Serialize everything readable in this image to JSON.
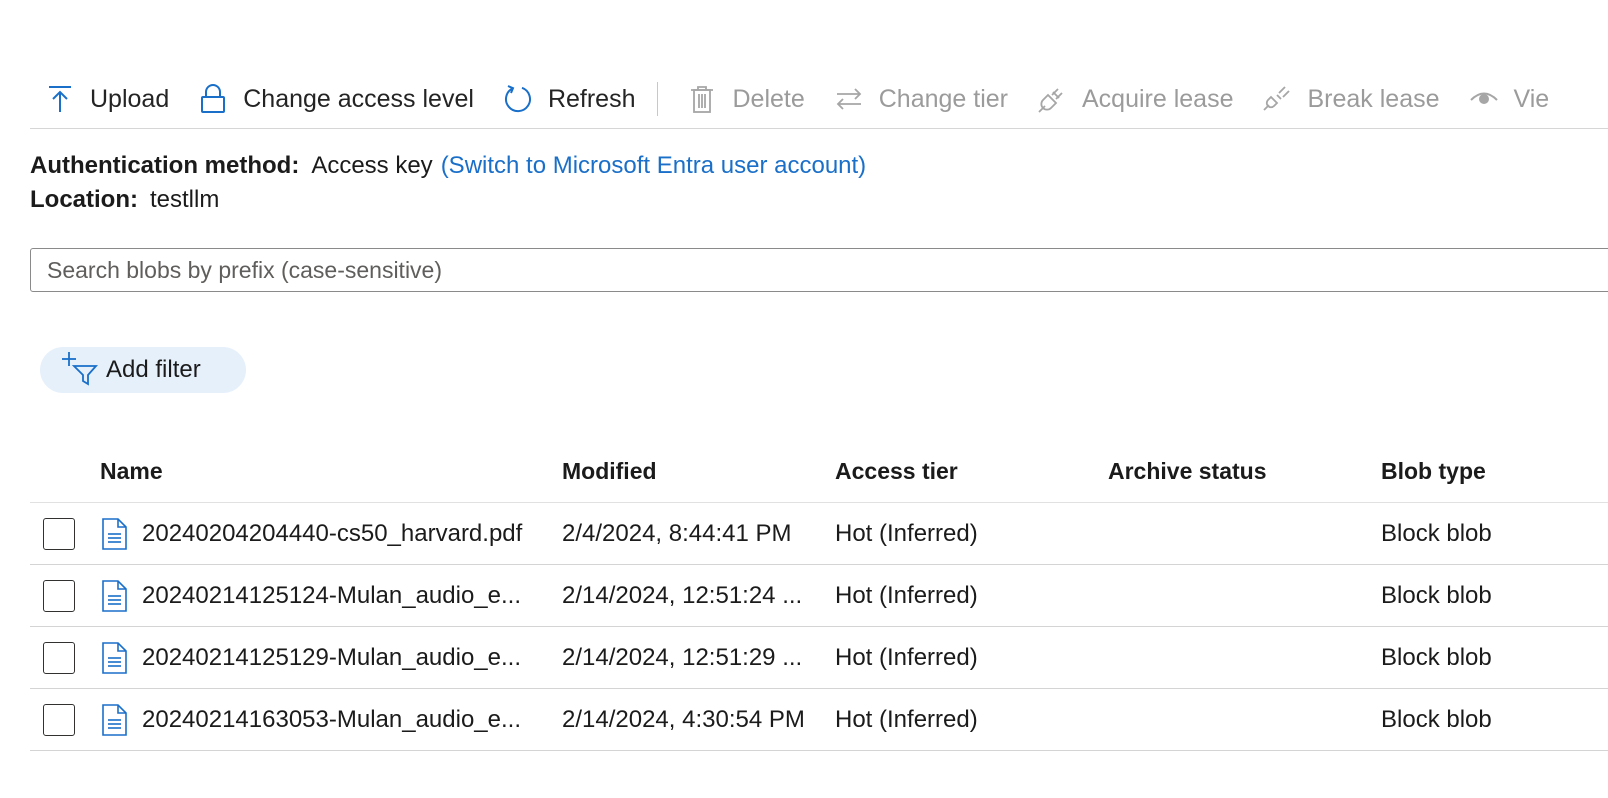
{
  "toolbar": {
    "upload": "Upload",
    "change_access": "Change access level",
    "refresh": "Refresh",
    "delete": "Delete",
    "change_tier": "Change tier",
    "acquire_lease": "Acquire lease",
    "break_lease": "Break lease",
    "view": "Vie"
  },
  "auth": {
    "method_label": "Authentication method:",
    "method_value": "Access key",
    "switch_link": "(Switch to Microsoft Entra user account)",
    "location_label": "Location:",
    "location_value": "testllm"
  },
  "search": {
    "placeholder": "Search blobs by prefix (case-sensitive)",
    "value": ""
  },
  "filter": {
    "label": "Add filter"
  },
  "table": {
    "headers": {
      "name": "Name",
      "modified": "Modified",
      "access_tier": "Access tier",
      "archive_status": "Archive status",
      "blob_type": "Blob type"
    },
    "rows": [
      {
        "name": "20240204204440-cs50_harvard.pdf",
        "modified": "2/4/2024, 8:44:41 PM",
        "tier": "Hot (Inferred)",
        "archive": "",
        "type": "Block blob"
      },
      {
        "name": "20240214125124-Mulan_audio_e...",
        "modified": "2/14/2024, 12:51:24 ...",
        "tier": "Hot (Inferred)",
        "archive": "",
        "type": "Block blob"
      },
      {
        "name": "20240214125129-Mulan_audio_e...",
        "modified": "2/14/2024, 12:51:29 ...",
        "tier": "Hot (Inferred)",
        "archive": "",
        "type": "Block blob"
      },
      {
        "name": "20240214163053-Mulan_audio_e...",
        "modified": "2/14/2024, 4:30:54 PM",
        "tier": "Hot (Inferred)",
        "archive": "",
        "type": "Block blob"
      }
    ]
  },
  "colors": {
    "accent": "#1a6fc9",
    "pill_bg": "#e6f0fb",
    "disabled": "#9b9b9b"
  },
  "icons": [
    "upload-icon",
    "lock-icon",
    "refresh-icon",
    "trash-icon",
    "swap-arrows-icon",
    "plug-icon",
    "plug-break-icon",
    "eye-icon",
    "add-filter-icon",
    "document-icon"
  ]
}
